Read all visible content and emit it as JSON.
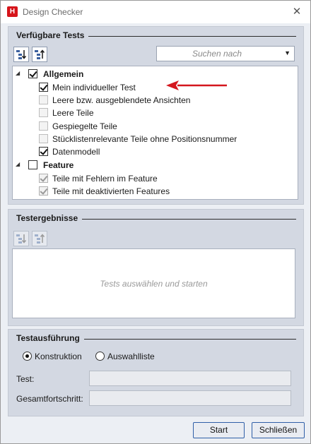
{
  "window": {
    "title": "Design Checker",
    "icon": "hicad-app-icon",
    "close_glyph": "✕"
  },
  "available_tests": {
    "title": "Verfügbare Tests",
    "search": {
      "placeholder": "Suchen nach"
    },
    "tree": [
      {
        "label": "Allgemein",
        "level": 0,
        "bold": true,
        "checked": true,
        "expanded": true
      },
      {
        "label": "Mein individueller Test",
        "level": 1,
        "checked": true,
        "highlighted_by_arrow": true
      },
      {
        "label": "Leere bzw. ausgeblendete Ansichten",
        "level": 1,
        "checked": false
      },
      {
        "label": "Leere Teile",
        "level": 1,
        "checked": false
      },
      {
        "label": "Gespiegelte Teile",
        "level": 1,
        "checked": false
      },
      {
        "label": "Stücklistenrelevante Teile ohne Positionsnummer",
        "level": 1,
        "checked": false
      },
      {
        "label": "Datenmodell",
        "level": 1,
        "checked": true
      },
      {
        "label": "Feature",
        "level": 0,
        "bold": true,
        "checked": false,
        "expanded": true
      },
      {
        "label": "Teile mit Fehlern im Feature",
        "level": 1,
        "checked": true,
        "disabled": true
      },
      {
        "label": "Teile mit deaktivierten Features",
        "level": 1,
        "checked": true,
        "disabled": true
      }
    ],
    "annotation_arrow_color": "#d4171e"
  },
  "test_results": {
    "title": "Testergebnisse",
    "placeholder": "Tests auswählen und starten"
  },
  "test_execution": {
    "title": "Testausführung",
    "modes": [
      {
        "label": "Konstruktion",
        "selected": true
      },
      {
        "label": "Auswahlliste",
        "selected": false
      }
    ],
    "test_label": "Test:",
    "test_value": "",
    "overall_progress_label": "Gesamtfortschritt:",
    "overall_progress_value": ""
  },
  "buttons": {
    "start": "Start",
    "close": "Schließen"
  }
}
